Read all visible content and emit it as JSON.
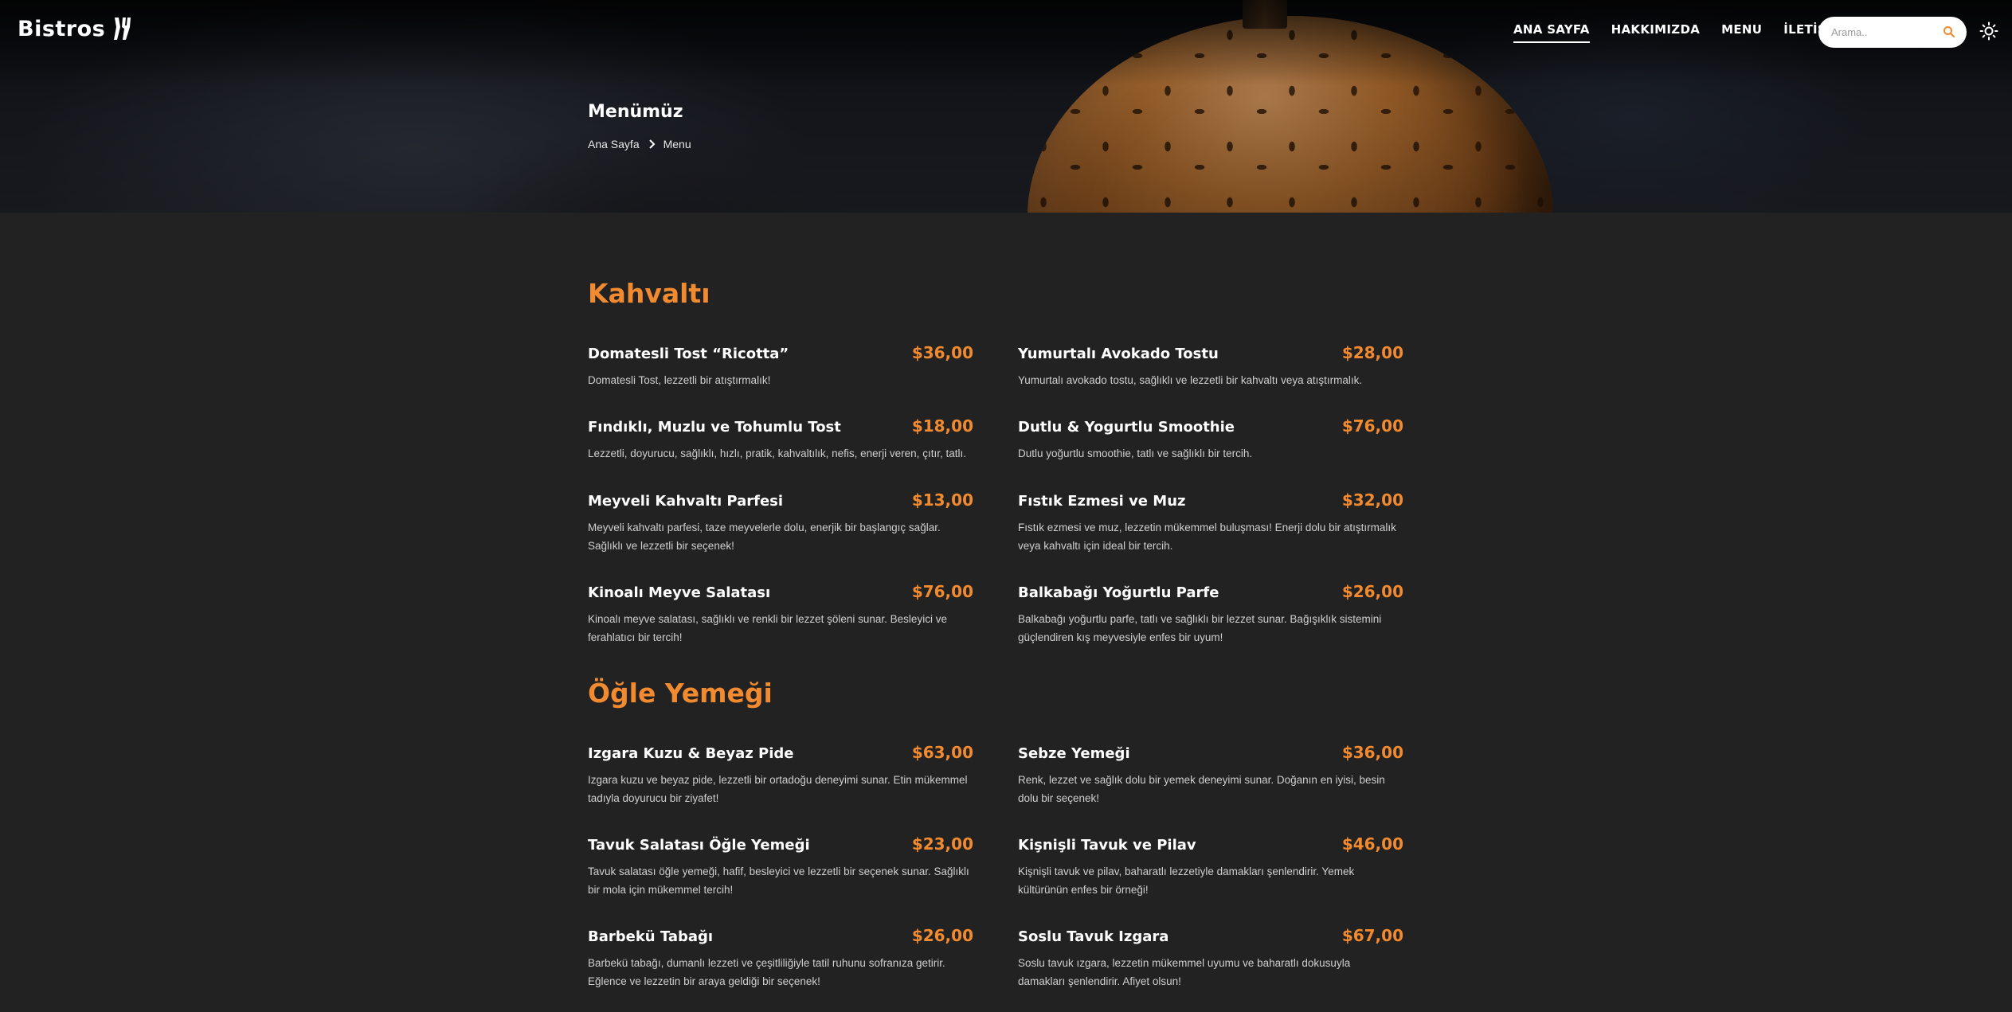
{
  "nav": {
    "logo": "Bistros",
    "links": [
      {
        "label": "ANA SAYFA",
        "active": true
      },
      {
        "label": "HAKKIMIZDA",
        "active": false
      },
      {
        "label": "MENU",
        "active": false
      },
      {
        "label": "İLETİŞİM",
        "active": false
      }
    ],
    "search_placeholder": "Arama..",
    "icons": {
      "search": "search-icon",
      "theme": "sun-icon"
    }
  },
  "hero": {
    "title": "Menümüz",
    "breadcrumb": {
      "home": "Ana Sayfa",
      "current": "Menu"
    }
  },
  "colors": {
    "accent": "#f28a2f",
    "background": "#222222"
  },
  "sections": [
    {
      "title": "Kahvaltı",
      "items": [
        {
          "name": "Domatesli Tost “Ricotta”",
          "price": "$36,00",
          "desc": "Domatesli Tost, lezzetli bir atıştırmalık!"
        },
        {
          "name": "Yumurtalı Avokado Tostu",
          "price": "$28,00",
          "desc": "Yumurtalı avokado tostu, sağlıklı ve lezzetli bir kahvaltı veya atıştırmalık."
        },
        {
          "name": "Fındıklı, Muzlu ve Tohumlu Tost",
          "price": "$18,00",
          "desc": "Lezzetli, doyurucu, sağlıklı, hızlı, pratik, kahvaltılık, nefis, enerji veren, çıtır, tatlı."
        },
        {
          "name": "Dutlu & Yogurtlu Smoothie",
          "price": "$76,00",
          "desc": "Dutlu yoğurtlu smoothie, tatlı ve sağlıklı bir tercih."
        },
        {
          "name": "Meyveli Kahvaltı Parfesi",
          "price": "$13,00",
          "desc": "Meyveli kahvaltı parfesi, taze meyvelerle dolu, enerjik bir başlangıç sağlar. Sağlıklı ve lezzetli bir seçenek!"
        },
        {
          "name": "Fıstık Ezmesi ve Muz",
          "price": "$32,00",
          "desc": "Fıstık ezmesi ve muz, lezzetin mükemmel buluşması! Enerji dolu bir atıştırmalık veya kahvaltı için ideal bir tercih."
        },
        {
          "name": "Kinoalı Meyve Salatası",
          "price": "$76,00",
          "desc": "Kinoalı meyve salatası, sağlıklı ve renkli bir lezzet şöleni sunar. Besleyici ve ferahlatıcı bir tercih!"
        },
        {
          "name": "Balkabağı Yoğurtlu Parfe",
          "price": "$26,00",
          "desc": "Balkabağı yoğurtlu parfe, tatlı ve sağlıklı bir lezzet sunar. Bağışıklık sistemini güçlendiren kış meyvesiyle enfes bir uyum!"
        }
      ]
    },
    {
      "title": "Öğle Yemeği",
      "items": [
        {
          "name": "Izgara Kuzu & Beyaz Pide",
          "price": "$63,00",
          "desc": "Izgara kuzu ve beyaz pide, lezzetli bir ortadoğu deneyimi sunar. Etin mükemmel tadıyla doyurucu bir ziyafet!"
        },
        {
          "name": "Sebze Yemeği",
          "price": "$36,00",
          "desc": "Renk, lezzet ve sağlık dolu bir yemek deneyimi sunar. Doğanın en iyisi, besin dolu bir seçenek!"
        },
        {
          "name": "Tavuk Salatası Öğle Yemeği",
          "price": "$23,00",
          "desc": "Tavuk salatası öğle yemeği, hafif, besleyici ve lezzetli bir seçenek sunar. Sağlıklı bir mola için mükemmel tercih!"
        },
        {
          "name": "Kişnişli Tavuk ve Pilav",
          "price": "$46,00",
          "desc": "Kişnişli tavuk ve pilav, baharatlı lezzetiyle damakları şenlendirir. Yemek kültürünün enfes bir örneği!"
        },
        {
          "name": "Barbekü Tabağı",
          "price": "$26,00",
          "desc": "Barbekü tabağı, dumanlı lezzeti ve çeşitliliğiyle tatil ruhunu sofranıza getirir. Eğlence ve lezzetin bir araya geldiği bir seçenek!"
        },
        {
          "name": "Soslu Tavuk Izgara",
          "price": "$67,00",
          "desc": "Soslu tavuk ızgara, lezzetin mükemmel uyumu ve baharatlı dokusuyla damakları şenlendirir. Afiyet olsun!"
        }
      ]
    }
  ]
}
